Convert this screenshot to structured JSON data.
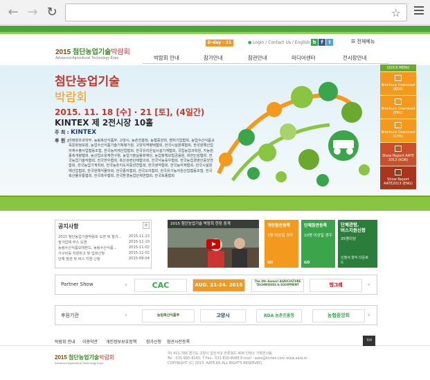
{
  "browser": {
    "back": "←",
    "forward": "→",
    "reload": "↻",
    "star": "☆",
    "url": ""
  },
  "header": {
    "logo_year": "2015 ",
    "logo_main": "첨단농업기술",
    "logo_sub": "박람회",
    "logo_en": "Advanced Agricultural Technology Expo",
    "dday": "D-day - 11",
    "util": "Login  /  Contact Us  /  English",
    "allmenu": "전체메뉴"
  },
  "gnb": [
    "박람회 안내",
    "참가안내",
    "참관안내",
    "미디어센터",
    "전시장안내"
  ],
  "hero": {
    "title1": "첨단농업기술",
    "title2": "박람회",
    "date": "2015. 11. 18 [수] · 21 [토], (4일간)",
    "venue": "KINTEX  제 2전시장 10홀",
    "host_label": "주 최 : ",
    "host": "KINTEX",
    "sponsor_label": "후 원 :",
    "sponsors": "미래창조과학부, 농림축산식품부, 고양시, 농촌진흥청, 농협중앙회, 벤처기업협회, 농업수산식품교육문화정보원, 농업수산식품기술기획평가원, 고양지역평택협회, 한국시설원예협회, 한국원예산업자재수출사업협동조합, 한국농자재산업협회, 한국유리온실시설기계협회, 국립농업과학원, 지농원 종축개량협회, 농산업소양계연구원, 농업기술실용화재단, 농업정책보험금융원, 대한인삼협회, 전국농업기술자협회, 전국한우협회, 축산관련단체협의회, 한국낙농육우협회, 한국농업경영인중앙연합회, 한국농업기계학회, 한국농촌지도자중앙연합회, 한국생약협회, 한국농자재협회, 한국시설원예산업협회, 한국원예식물학회, 한국종자협회, 한국오리협회, 한국유기농자원산업협동조합, 한국축산물유통협회, 한국흑우협회, 한국환경농업단체연합회, 한국토종협회"
  },
  "quick": {
    "title": "QUICK MENU",
    "items": [
      {
        "label": "Brochure Download (KOR)",
        "color": "#f39a1e"
      },
      {
        "label": "Brochure Download (ENG)",
        "color": "#f39a1e"
      },
      {
        "label": "Brochure Download (CHN)",
        "color": "#f39a1e"
      },
      {
        "label": "Show Report AATE 2013 (KOR)",
        "color": "#c7512a"
      },
      {
        "label": "Show Report AATE2013 (ENG)",
        "color": "#a6371f"
      }
    ]
  },
  "notice": {
    "title": "공지사항",
    "more": "+",
    "items": [
      {
        "t": "2015 첨단농업기술박람회 도면 및 참가...",
        "d": "2015-11-13"
      },
      {
        "t": "참가업체 부스 도면",
        "d": "2015-11-10"
      },
      {
        "t": "농림수산식품모태펀드, 농림수산식품...",
        "d": "2015-11-02"
      },
      {
        "t": "가구비를 지원하고 및 입대신청",
        "d": "2015-11-02"
      },
      {
        "t": "단체 참관 및 버스 지원 신청",
        "d": "2015-08-04"
      }
    ]
  },
  "video": {
    "title": "2015 첨단농업기술 박람회 현장 중계"
  },
  "reg": [
    {
      "t": "개인참관등록",
      "s": "1명 이상일 경우",
      "go": "GO",
      "color": "#f39a1e"
    },
    {
      "t": "단체참관등록",
      "s": "10명 이상일 경우",
      "go": "GO",
      "color": "#3aa54a"
    },
    {
      "t": "단체관람,\n버스지원신청",
      "s": "35명이상",
      "go": "신청서 양식 다운로드",
      "color": "#2a7d3a"
    }
  ],
  "partner": {
    "title": "Partner Show",
    "items": [
      "CAC",
      "AUG. 21-24. 2015",
      "The 4th Aomori AGRICULTURE TECHNIQUES & EQUIPMENT",
      "빙그레"
    ]
  },
  "support": {
    "title": "후원기관",
    "items": [
      "농림축산식품부",
      "고양시",
      "RDA 농촌진흥청",
      "농협중앙회"
    ]
  },
  "footer": {
    "nav": [
      "박람회 안내",
      "이용약관",
      "개인정보보호정책",
      "참가신청",
      "참관사전등록"
    ],
    "top": "TOP",
    "addr": "우) 411-766  경기도 고양시 일산서구 한류월드 408 킨텍스 기획전시팀",
    "tel": "Tel : 031-995-8143, 7   Fax : 031-810-8088   E-mail : aate@kintex.com   www.aate.kr",
    "copy": "COPYRIGHT (C) 2013. AATE.KR  ALL RIGHTS RESERVED."
  }
}
